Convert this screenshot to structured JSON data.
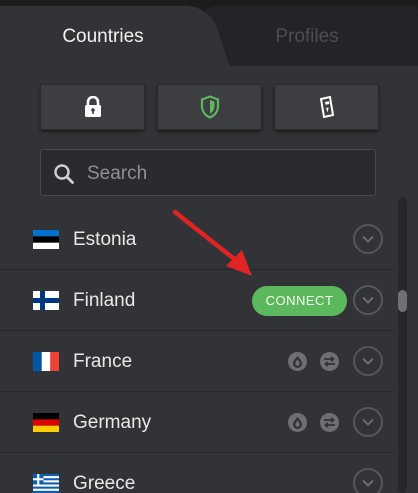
{
  "tabs": {
    "countries": "Countries",
    "profiles": "Profiles"
  },
  "quick_actions": [
    {
      "icon": "lock-icon"
    },
    {
      "icon": "shield-icon"
    },
    {
      "icon": "secure-core-card-icon"
    }
  ],
  "search": {
    "placeholder": "Search",
    "value": ""
  },
  "countries": [
    {
      "name": "Estonia",
      "flag": "estonia-flag-icon",
      "features": [],
      "connect": false
    },
    {
      "name": "Finland",
      "flag": "finland-flag-icon",
      "features": [],
      "connect": true,
      "connect_label": "CONNECT"
    },
    {
      "name": "France",
      "flag": "france-flag-icon",
      "features": [
        "tor-onion-icon",
        "p2p-arrows-icon"
      ],
      "connect": false
    },
    {
      "name": "Germany",
      "flag": "germany-flag-icon",
      "features": [
        "tor-onion-icon",
        "p2p-arrows-icon"
      ],
      "connect": false
    },
    {
      "name": "Greece",
      "flag": "greece-flag-icon",
      "features": [],
      "connect": false
    }
  ],
  "colors": {
    "accent_green": "#5cb85c",
    "annotation_red": "#e02424",
    "shield_green": "#5cb85c"
  }
}
